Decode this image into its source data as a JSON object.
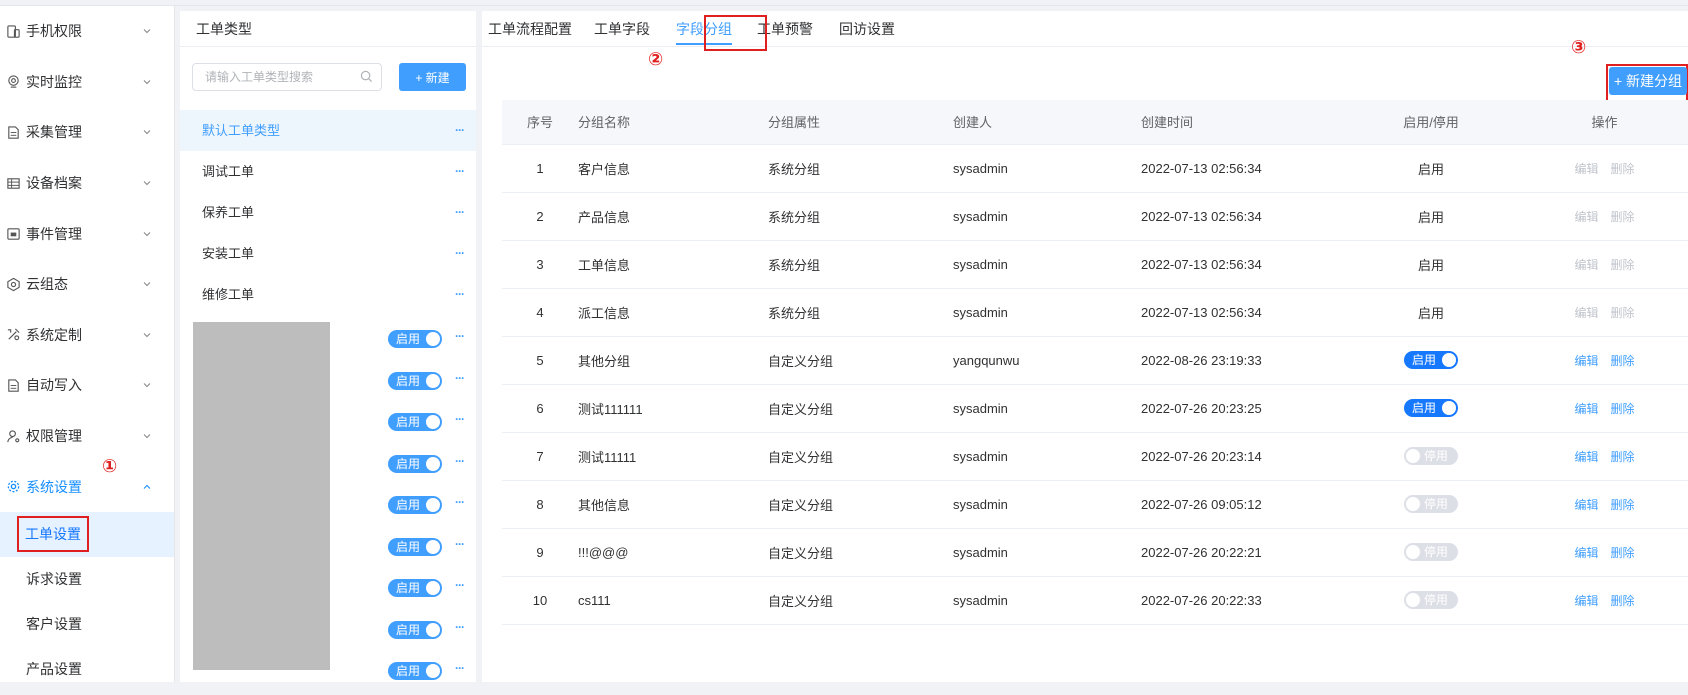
{
  "nav": {
    "items": [
      {
        "label": "手机权限",
        "icon": "phone-icon"
      },
      {
        "label": "实时监控",
        "icon": "monitor-icon"
      },
      {
        "label": "采集管理",
        "icon": "document-icon"
      },
      {
        "label": "设备档案",
        "icon": "grid-icon"
      },
      {
        "label": "事件管理",
        "icon": "calendar-icon"
      },
      {
        "label": "云组态",
        "icon": "cloud-gear-icon"
      },
      {
        "label": "系统定制",
        "icon": "tools-icon"
      },
      {
        "label": "自动写入",
        "icon": "document-icon"
      },
      {
        "label": "权限管理",
        "icon": "user-key-icon"
      },
      {
        "label": "系统设置",
        "icon": "gear-icon"
      }
    ],
    "subitems": [
      {
        "label": "工单设置"
      },
      {
        "label": "诉求设置"
      },
      {
        "label": "客户设置"
      },
      {
        "label": "产品设置"
      }
    ],
    "marker": "①"
  },
  "types": {
    "title": "工单类型",
    "search_placeholder": "请输入工单类型搜索",
    "new_button": "+ 新建",
    "items": [
      {
        "label": "默认工单类型"
      },
      {
        "label": "调试工单"
      },
      {
        "label": "保养工单"
      },
      {
        "label": "安装工单"
      },
      {
        "label": "维修工单"
      }
    ],
    "more": "···",
    "toggle_label": "启用",
    "toggle_rows": 9
  },
  "tabs": {
    "items": [
      "工单流程配置",
      "工单字段",
      "字段分组",
      "工单预警",
      "回访设置"
    ],
    "active": 2,
    "marker": "②"
  },
  "toolbar": {
    "new_group": "+ 新建分组",
    "marker": "③"
  },
  "table": {
    "headers": [
      "序号",
      "分组名称",
      "分组属性",
      "创建人",
      "创建时间",
      "启用/停用",
      "操作"
    ],
    "edit_label": "编辑",
    "delete_label": "删除",
    "rows": [
      {
        "idx": "1",
        "name": "客户信息",
        "attr": "系统分组",
        "user": "sysadmin",
        "time": "2022-07-13 02:56:34",
        "status": "启用",
        "kind": "text"
      },
      {
        "idx": "2",
        "name": "产品信息",
        "attr": "系统分组",
        "user": "sysadmin",
        "time": "2022-07-13 02:56:34",
        "status": "启用",
        "kind": "text"
      },
      {
        "idx": "3",
        "name": "工单信息",
        "attr": "系统分组",
        "user": "sysadmin",
        "time": "2022-07-13 02:56:34",
        "status": "启用",
        "kind": "text"
      },
      {
        "idx": "4",
        "name": "派工信息",
        "attr": "系统分组",
        "user": "sysadmin",
        "time": "2022-07-13 02:56:34",
        "status": "启用",
        "kind": "text"
      },
      {
        "idx": "5",
        "name": "其他分组",
        "attr": "自定义分组",
        "user": "yangqunwu",
        "time": "2022-08-26 23:19:33",
        "status": "启用",
        "kind": "on"
      },
      {
        "idx": "6",
        "name": "测试111111",
        "attr": "自定义分组",
        "user": "sysadmin",
        "time": "2022-07-26 20:23:25",
        "status": "启用",
        "kind": "on"
      },
      {
        "idx": "7",
        "name": "测试11111",
        "attr": "自定义分组",
        "user": "sysadmin",
        "time": "2022-07-26 20:23:14",
        "status": "停用",
        "kind": "off"
      },
      {
        "idx": "8",
        "name": "其他信息",
        "attr": "自定义分组",
        "user": "sysadmin",
        "time": "2022-07-26 09:05:12",
        "status": "停用",
        "kind": "off"
      },
      {
        "idx": "9",
        "name": "!!!@@@",
        "attr": "自定义分组",
        "user": "sysadmin",
        "time": "2022-07-26 20:22:21",
        "status": "停用",
        "kind": "off"
      },
      {
        "idx": "10",
        "name": "cs111",
        "attr": "自定义分组",
        "user": "sysadmin",
        "time": "2022-07-26 20:22:33",
        "status": "停用",
        "kind": "off"
      }
    ]
  }
}
